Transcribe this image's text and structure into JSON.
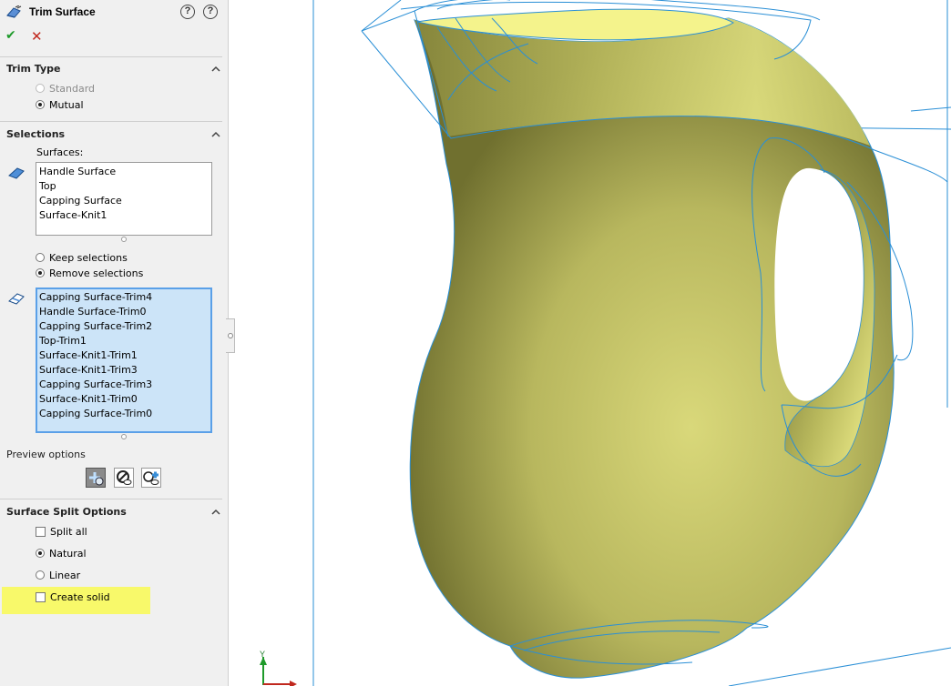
{
  "feature": {
    "title": "Trim Surface"
  },
  "actions": {
    "ok_icon": "check-icon",
    "cancel_icon": "cross-icon",
    "help_icon": "help-icon",
    "detailed_help_icon": "question-icon"
  },
  "trim_type": {
    "title": "Trim Type",
    "options": [
      {
        "label": "Standard",
        "selected": false,
        "enabled": false
      },
      {
        "label": "Mutual",
        "selected": true,
        "enabled": true
      }
    ]
  },
  "selections": {
    "title": "Selections",
    "surfaces_label": "Surfaces:",
    "surfaces": [
      "Handle Surface",
      "Top",
      "Capping Surface",
      "Surface-Knit1"
    ],
    "keep_options": [
      {
        "label": "Keep selections",
        "selected": false
      },
      {
        "label": "Remove selections",
        "selected": true
      }
    ],
    "pieces": [
      "Capping Surface-Trim4",
      "Handle Surface-Trim0",
      "Capping Surface-Trim2",
      "Top-Trim1",
      "Surface-Knit1-Trim1",
      "Surface-Knit1-Trim3",
      "Capping Surface-Trim3",
      "Surface-Knit1-Trim0",
      "Capping Surface-Trim0"
    ]
  },
  "preview": {
    "title": "Preview options",
    "buttons": [
      "show-included-icon",
      "show-excluded-icon",
      "show-both-icon"
    ],
    "active_index": 0
  },
  "split_options": {
    "title": "Surface Split Options",
    "split_all": {
      "label": "Split all",
      "checked": false
    },
    "modes": [
      {
        "label": "Natural",
        "selected": true
      },
      {
        "label": "Linear",
        "selected": false
      }
    ],
    "create_solid": {
      "label": "Create solid",
      "checked": false,
      "highlight_color": "#f8f96a"
    }
  },
  "viewport": {
    "triad_axis": "Y",
    "surface_color": "#e6e488",
    "edge_color": "#2a8fd6"
  }
}
